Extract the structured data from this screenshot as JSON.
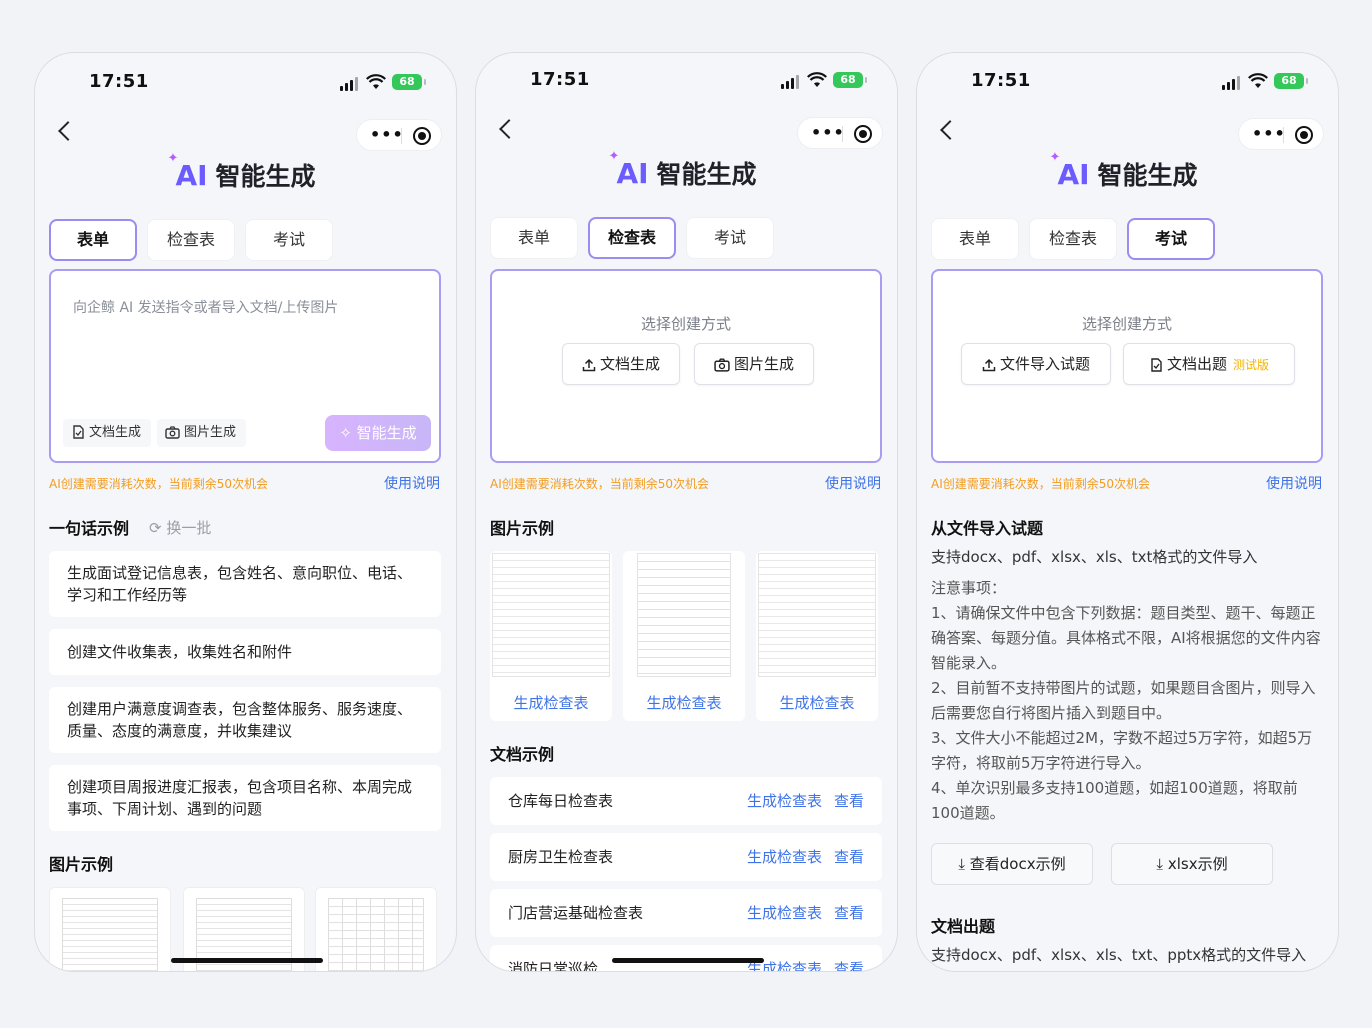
{
  "status": {
    "time": "17:51",
    "battery": "68"
  },
  "brand": {
    "ai": "AI",
    "title": "智能生成"
  },
  "tabs": [
    "表单",
    "检查表",
    "考试"
  ],
  "footer": {
    "tip": "AI创建需要消耗次数，当前剩余50次机会",
    "howto": "使用说明"
  },
  "screen1": {
    "placeholder": "向企鲸 AI 发送指令或者导入文档/上传图片",
    "doc_btn": "文档生成",
    "img_btn": "图片生成",
    "gen_btn": "智能生成",
    "examples_title": "一句话示例",
    "refresh": "换一批",
    "examples": [
      "生成面试登记信息表，包含姓名、意向职位、电话、学习和工作经历等",
      "创建文件收集表，收集姓名和附件",
      "创建用户满意度调查表，包含整体服务、服务速度、质量、态度的满意度，并收集建议",
      "创建项目周报进度汇报表，包含项目名称、本周完成事项、下周计划、遇到的问题"
    ],
    "image_section": "图片示例"
  },
  "screen2": {
    "choose": "选择创建方式",
    "doc_btn": "文档生成",
    "img_btn": "图片生成",
    "image_section": "图片示例",
    "image_cards": [
      "生成检查表",
      "生成检查表",
      "生成检查表"
    ],
    "doc_section": "文档示例",
    "doc_rows": [
      {
        "name": "仓库每日检查表",
        "gen": "生成检查表",
        "view": "查看"
      },
      {
        "name": "厨房卫生检查表",
        "gen": "生成检查表",
        "view": "查看"
      },
      {
        "name": "门店营运基础检查表",
        "gen": "生成检查表",
        "view": "查看"
      },
      {
        "name": "消防日常巡检",
        "gen": "生成检查表",
        "view": "查看"
      }
    ]
  },
  "screen3": {
    "choose": "选择创建方式",
    "import_btn": "文件导入试题",
    "doc_btn": "文档出题",
    "beta": "测试版",
    "import_title": "从文件导入试题",
    "formats": "支持docx、pdf、xlsx、xls、txt格式的文件导入",
    "notes_title": "注意事项：",
    "notes": [
      "1、请确保文件中包含下列数据：题目类型、题干、每题正确答案、每题分值。具体格式不限，AI将根据您的文件内容智能录入。",
      "2、目前暂不支持带图片的试题，如果题目含图片，则导入后需要您自行将图片插入到题目中。",
      "3、文件大小不能超过2M，字数不超过5万字符，如超5万字符，将取前5万字符进行导入。",
      "4、单次识别最多支持100道题，如超100道题，将取前100道题。"
    ],
    "dl_docx": "查看docx示例",
    "dl_xlsx": "xlsx示例",
    "doc_title": "文档出题",
    "doc_formats": "支持docx、pdf、xlsx、xls、txt、pptx格式的文件导入"
  }
}
